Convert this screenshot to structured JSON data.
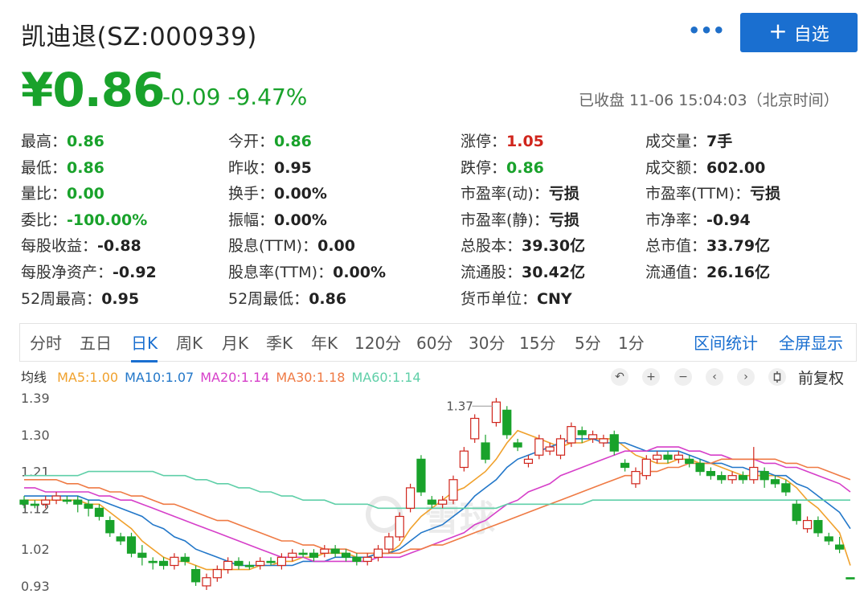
{
  "header": {
    "stock_name": "凯迪退(SZ:000939)",
    "more_glyph": "•••",
    "add_plus": "+",
    "add_label": "自选"
  },
  "quote": {
    "price": "¥0.86",
    "change": "-0.09  -9.47%",
    "status": "已收盘 11-06 15:04:03（北京时间）"
  },
  "stats": [
    [
      {
        "label": "最高：",
        "value": "0.86",
        "tone": "green"
      },
      {
        "label": "最低：",
        "value": "0.86",
        "tone": "green"
      },
      {
        "label": "量比：",
        "value": "0.00",
        "tone": "green"
      },
      {
        "label": "委比：",
        "value": "-100.00%",
        "tone": "green"
      },
      {
        "label": "每股收益：",
        "value": "-0.88",
        "tone": "dark"
      },
      {
        "label": "每股净资产：",
        "value": "-0.92",
        "tone": "dark"
      },
      {
        "label": "52周最高：",
        "value": "0.95",
        "tone": "dark"
      }
    ],
    [
      {
        "label": "今开：",
        "value": "0.86",
        "tone": "green"
      },
      {
        "label": "昨收：",
        "value": "0.95",
        "tone": "dark"
      },
      {
        "label": "换手：",
        "value": "0.00%",
        "tone": "dark"
      },
      {
        "label": "振幅：",
        "value": "0.00%",
        "tone": "dark"
      },
      {
        "label": "股息(TTM)：",
        "value": "0.00",
        "tone": "dark"
      },
      {
        "label": "股息率(TTM)：",
        "value": "0.00%",
        "tone": "dark"
      },
      {
        "label": "52周最低：",
        "value": "0.86",
        "tone": "dark"
      }
    ],
    [
      {
        "label": "涨停：",
        "value": "1.05",
        "tone": "red"
      },
      {
        "label": "跌停：",
        "value": "0.86",
        "tone": "green"
      },
      {
        "label": "市盈率(动)：",
        "value": "亏损",
        "tone": "dark"
      },
      {
        "label": "市盈率(静)：",
        "value": "亏损",
        "tone": "dark"
      },
      {
        "label": "总股本：",
        "value": "39.30亿",
        "tone": "dark"
      },
      {
        "label": "流通股：",
        "value": "30.42亿",
        "tone": "dark"
      },
      {
        "label": "货币单位：",
        "value": "CNY",
        "tone": "dark"
      }
    ],
    [
      {
        "label": "成交量：",
        "value": "7手",
        "tone": "dark"
      },
      {
        "label": "成交额：",
        "value": "602.00",
        "tone": "dark"
      },
      {
        "label": "市盈率(TTM)：",
        "value": "亏损",
        "tone": "dark"
      },
      {
        "label": "市净率：",
        "value": "-0.94",
        "tone": "dark"
      },
      {
        "label": "总市值：",
        "value": "33.79亿",
        "tone": "dark"
      },
      {
        "label": "流通值：",
        "value": "26.16亿",
        "tone": "dark"
      }
    ]
  ],
  "tabs": [
    "分时",
    "五日",
    "日K",
    "周K",
    "月K",
    "季K",
    "年K",
    "120分",
    "60分",
    "30分",
    "15分",
    "5分",
    "1分"
  ],
  "active_tab": "日K",
  "links": {
    "range_stats": "区间统计",
    "fullscreen": "全屏显示"
  },
  "ma": {
    "label": "均线",
    "items": [
      {
        "text": "MA5:1.00",
        "color": "#f0a12c"
      },
      {
        "text": "MA10:1.07",
        "color": "#2277c9"
      },
      {
        "text": "MA20:1.14",
        "color": "#d63fc9"
      },
      {
        "text": "MA30:1.18",
        "color": "#ef7a44"
      },
      {
        "text": "MA60:1.14",
        "color": "#5fcfa8"
      }
    ]
  },
  "controls": {
    "undo_glyph": "↶",
    "zoom_in_glyph": "+",
    "zoom_out_glyph": "−",
    "left_glyph": "‹",
    "right_glyph": "›",
    "adjust_label": "前复权"
  },
  "watermark": "雪球",
  "colors": {
    "up": "#d0251c",
    "down": "#19a22b",
    "accent": "#1a6fd0"
  },
  "chart_data": {
    "type": "candlestick",
    "y_ticks": [
      1.39,
      1.3,
      1.21,
      1.12,
      1.02,
      0.93
    ],
    "ylim": [
      0.92,
      1.4
    ],
    "max_annotation": "1.37",
    "max_value": 1.37,
    "candles": [
      [
        1.14,
        1.13,
        1.15,
        1.12
      ],
      [
        1.13,
        1.13,
        1.14,
        1.12
      ],
      [
        1.13,
        1.14,
        1.15,
        1.12
      ],
      [
        1.14,
        1.15,
        1.16,
        1.13
      ],
      [
        1.14,
        1.14,
        1.15,
        1.13
      ],
      [
        1.14,
        1.13,
        1.15,
        1.11
      ],
      [
        1.13,
        1.12,
        1.14,
        1.1
      ],
      [
        1.12,
        1.1,
        1.13,
        1.09
      ],
      [
        1.09,
        1.06,
        1.1,
        1.05
      ],
      [
        1.05,
        1.04,
        1.06,
        1.03
      ],
      [
        1.05,
        1.01,
        1.06,
        1.0
      ],
      [
        1.01,
        1.0,
        1.03,
        0.98
      ],
      [
        0.99,
        0.99,
        1.0,
        0.97
      ],
      [
        0.99,
        0.98,
        1.0,
        0.97
      ],
      [
        0.98,
        1.0,
        1.01,
        0.97
      ],
      [
        1.0,
        0.99,
        1.01,
        0.98
      ],
      [
        0.97,
        0.94,
        0.98,
        0.93
      ],
      [
        0.93,
        0.95,
        0.96,
        0.92
      ],
      [
        0.95,
        0.97,
        0.98,
        0.94
      ],
      [
        0.97,
        0.99,
        1.0,
        0.96
      ],
      [
        0.99,
        0.98,
        1.0,
        0.97
      ],
      [
        0.98,
        0.98,
        0.99,
        0.97
      ],
      [
        0.98,
        0.99,
        1.0,
        0.97
      ],
      [
        0.99,
        0.99,
        1.0,
        0.98
      ],
      [
        0.98,
        1.0,
        1.01,
        0.97
      ],
      [
        1.0,
        1.01,
        1.02,
        0.99
      ],
      [
        1.01,
        1.01,
        1.02,
        1.0
      ],
      [
        1.01,
        1.0,
        1.02,
        0.99
      ],
      [
        1.01,
        1.02,
        1.03,
        1.0
      ],
      [
        1.02,
        1.01,
        1.03,
        1.0
      ],
      [
        1.01,
        1.0,
        1.02,
        0.99
      ],
      [
        1.0,
        0.99,
        1.01,
        0.98
      ],
      [
        0.99,
        1.0,
        1.01,
        0.98
      ],
      [
        1.0,
        1.02,
        1.03,
        0.99
      ],
      [
        1.02,
        1.05,
        1.06,
        1.01
      ],
      [
        1.05,
        1.1,
        1.11,
        1.04
      ],
      [
        1.12,
        1.17,
        1.18,
        1.11
      ],
      [
        1.24,
        1.16,
        1.25,
        1.15
      ],
      [
        1.14,
        1.13,
        1.15,
        1.12
      ],
      [
        1.13,
        1.14,
        1.15,
        1.12
      ],
      [
        1.14,
        1.19,
        1.2,
        1.13
      ],
      [
        1.22,
        1.26,
        1.27,
        1.21
      ],
      [
        1.29,
        1.34,
        1.35,
        1.28
      ],
      [
        1.28,
        1.24,
        1.3,
        1.23
      ],
      [
        1.33,
        1.38,
        1.39,
        1.32
      ],
      [
        1.36,
        1.3,
        1.37,
        1.29
      ],
      [
        1.28,
        1.27,
        1.29,
        1.26
      ],
      [
        1.23,
        1.24,
        1.25,
        1.22
      ],
      [
        1.25,
        1.29,
        1.3,
        1.24
      ],
      [
        1.26,
        1.27,
        1.28,
        1.25
      ],
      [
        1.25,
        1.29,
        1.3,
        1.24
      ],
      [
        1.28,
        1.32,
        1.33,
        1.27
      ],
      [
        1.31,
        1.3,
        1.32,
        1.28
      ],
      [
        1.29,
        1.3,
        1.31,
        1.28
      ],
      [
        1.28,
        1.29,
        1.3,
        1.27
      ],
      [
        1.3,
        1.26,
        1.31,
        1.25
      ],
      [
        1.23,
        1.22,
        1.24,
        1.21
      ],
      [
        1.18,
        1.21,
        1.22,
        1.17
      ],
      [
        1.2,
        1.24,
        1.25,
        1.19
      ],
      [
        1.24,
        1.25,
        1.26,
        1.23
      ],
      [
        1.25,
        1.24,
        1.26,
        1.23
      ],
      [
        1.24,
        1.25,
        1.26,
        1.23
      ],
      [
        1.24,
        1.23,
        1.25,
        1.22
      ],
      [
        1.23,
        1.21,
        1.24,
        1.2
      ],
      [
        1.21,
        1.2,
        1.22,
        1.19
      ],
      [
        1.2,
        1.19,
        1.21,
        1.18
      ],
      [
        1.19,
        1.2,
        1.21,
        1.18
      ],
      [
        1.2,
        1.19,
        1.21,
        1.18
      ],
      [
        1.19,
        1.22,
        1.27,
        1.18
      ],
      [
        1.21,
        1.19,
        1.22,
        1.17
      ],
      [
        1.19,
        1.18,
        1.2,
        1.17
      ],
      [
        1.18,
        1.16,
        1.19,
        1.15
      ],
      [
        1.13,
        1.09,
        1.14,
        1.08
      ],
      [
        1.07,
        1.09,
        1.1,
        1.06
      ],
      [
        1.09,
        1.06,
        1.1,
        1.05
      ],
      [
        1.05,
        1.04,
        1.06,
        1.03
      ],
      [
        1.03,
        1.02,
        1.05,
        1.01
      ],
      [
        0.95,
        0.95,
        0.95,
        0.95
      ]
    ],
    "ma_series": [
      {
        "name": "MA5",
        "color": "#f0a12c",
        "values": [
          1.14,
          1.14,
          1.14,
          1.14,
          1.14,
          1.14,
          1.13,
          1.13,
          1.11,
          1.09,
          1.07,
          1.04,
          1.02,
          1.0,
          0.99,
          0.99,
          0.98,
          0.97,
          0.97,
          0.97,
          0.97,
          0.97,
          0.98,
          0.98,
          0.99,
          0.99,
          1.0,
          1.0,
          1.01,
          1.01,
          1.01,
          1.0,
          1.0,
          1.01,
          1.01,
          1.03,
          1.07,
          1.1,
          1.12,
          1.14,
          1.16,
          1.17,
          1.19,
          1.21,
          1.24,
          1.28,
          1.31,
          1.3,
          1.29,
          1.28,
          1.27,
          1.28,
          1.28,
          1.29,
          1.29,
          1.29,
          1.27,
          1.25,
          1.24,
          1.23,
          1.23,
          1.24,
          1.24,
          1.23,
          1.23,
          1.22,
          1.21,
          1.2,
          1.2,
          1.2,
          1.2,
          1.19,
          1.17,
          1.14,
          1.12,
          1.09,
          1.06,
          0.98
        ]
      },
      {
        "name": "MA10",
        "color": "#2277c9",
        "values": [
          1.15,
          1.15,
          1.15,
          1.15,
          1.15,
          1.15,
          1.14,
          1.14,
          1.13,
          1.12,
          1.11,
          1.1,
          1.08,
          1.07,
          1.05,
          1.04,
          1.02,
          1.01,
          1.0,
          0.99,
          0.98,
          0.98,
          0.98,
          0.98,
          0.98,
          0.98,
          0.99,
          0.99,
          0.99,
          1.0,
          1.0,
          1.0,
          1.0,
          1.01,
          1.01,
          1.02,
          1.04,
          1.06,
          1.07,
          1.08,
          1.1,
          1.12,
          1.15,
          1.17,
          1.19,
          1.22,
          1.24,
          1.25,
          1.26,
          1.27,
          1.28,
          1.29,
          1.29,
          1.29,
          1.28,
          1.28,
          1.28,
          1.27,
          1.26,
          1.26,
          1.26,
          1.26,
          1.25,
          1.24,
          1.23,
          1.23,
          1.22,
          1.22,
          1.21,
          1.21,
          1.2,
          1.2,
          1.18,
          1.17,
          1.15,
          1.13,
          1.11,
          1.07
        ]
      },
      {
        "name": "MA20",
        "color": "#d63fc9",
        "values": [
          1.17,
          1.17,
          1.16,
          1.16,
          1.16,
          1.16,
          1.16,
          1.15,
          1.15,
          1.14,
          1.14,
          1.13,
          1.12,
          1.11,
          1.1,
          1.09,
          1.08,
          1.07,
          1.06,
          1.05,
          1.04,
          1.03,
          1.02,
          1.01,
          1.0,
          1.0,
          1.0,
          0.99,
          0.99,
          0.99,
          0.99,
          0.99,
          0.99,
          1.0,
          1.0,
          1.0,
          1.01,
          1.02,
          1.03,
          1.04,
          1.05,
          1.06,
          1.08,
          1.09,
          1.11,
          1.13,
          1.14,
          1.16,
          1.17,
          1.18,
          1.2,
          1.21,
          1.22,
          1.23,
          1.24,
          1.25,
          1.26,
          1.26,
          1.26,
          1.27,
          1.27,
          1.27,
          1.26,
          1.26,
          1.25,
          1.25,
          1.24,
          1.24,
          1.24,
          1.23,
          1.23,
          1.22,
          1.22,
          1.21,
          1.2,
          1.19,
          1.18,
          1.16
        ]
      },
      {
        "name": "MA30",
        "color": "#ef7a44",
        "values": [
          1.19,
          1.19,
          1.19,
          1.19,
          1.18,
          1.18,
          1.17,
          1.17,
          1.16,
          1.16,
          1.15,
          1.15,
          1.14,
          1.13,
          1.13,
          1.12,
          1.11,
          1.1,
          1.09,
          1.09,
          1.08,
          1.07,
          1.06,
          1.05,
          1.04,
          1.04,
          1.03,
          1.03,
          1.02,
          1.02,
          1.02,
          1.01,
          1.01,
          1.01,
          1.01,
          1.01,
          1.02,
          1.02,
          1.03,
          1.03,
          1.04,
          1.05,
          1.06,
          1.07,
          1.08,
          1.09,
          1.1,
          1.11,
          1.12,
          1.13,
          1.14,
          1.15,
          1.16,
          1.17,
          1.18,
          1.19,
          1.2,
          1.2,
          1.21,
          1.21,
          1.22,
          1.22,
          1.23,
          1.23,
          1.23,
          1.24,
          1.24,
          1.24,
          1.24,
          1.24,
          1.24,
          1.23,
          1.23,
          1.22,
          1.22,
          1.21,
          1.2,
          1.19
        ]
      },
      {
        "name": "MA60",
        "color": "#5fcfa8",
        "values": [
          1.2,
          1.2,
          1.2,
          1.2,
          1.2,
          1.2,
          1.21,
          1.21,
          1.21,
          1.21,
          1.21,
          1.21,
          1.21,
          1.2,
          1.2,
          1.2,
          1.19,
          1.19,
          1.18,
          1.18,
          1.17,
          1.17,
          1.16,
          1.16,
          1.15,
          1.15,
          1.14,
          1.14,
          1.14,
          1.13,
          1.13,
          1.13,
          1.13,
          1.12,
          1.12,
          1.12,
          1.12,
          1.12,
          1.12,
          1.12,
          1.12,
          1.12,
          1.12,
          1.12,
          1.12,
          1.13,
          1.13,
          1.13,
          1.13,
          1.13,
          1.13,
          1.13,
          1.13,
          1.14,
          1.14,
          1.14,
          1.14,
          1.14,
          1.14,
          1.14,
          1.14,
          1.14,
          1.14,
          1.14,
          1.14,
          1.14,
          1.14,
          1.14,
          1.14,
          1.14,
          1.14,
          1.14,
          1.14,
          1.14,
          1.14,
          1.14,
          1.14,
          1.14
        ]
      }
    ]
  }
}
